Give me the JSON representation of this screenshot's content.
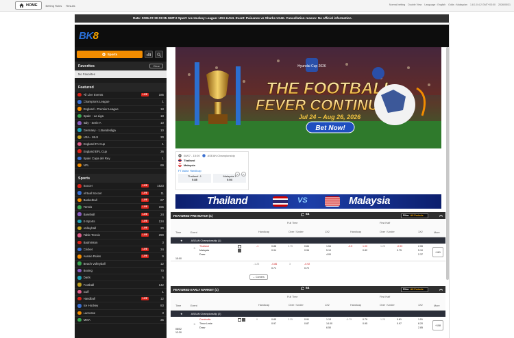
{
  "topbar": {
    "home": "HOME",
    "links": [
      "Betting Rules",
      "Results"
    ],
    "right": [
      "Normal betting",
      "Double View",
      "Language : English",
      "Odds : Malaysian",
      "1.8.1.0.4.2 GMT+03:00",
      "2026/05/31"
    ]
  },
  "notice": "Date: 2026-07-30 03:35 GMT-2 Sport: Ice Hockey League: USA UAHL Event: Paisanos vs Sharks UAHL Cancellation reason: No official information.",
  "brand": {
    "logo_a": "BK",
    "logo_b": "8"
  },
  "sidebar": {
    "sports_tab": "Sports",
    "favorites": "Favorites",
    "clear": "Clear",
    "no_favorites": "No Favorites",
    "featured": "Featured",
    "featured_items": [
      {
        "name": "All Live Events",
        "live": "LIVE",
        "count": "185"
      },
      {
        "name": "Champions League",
        "count": "1"
      },
      {
        "name": "England - Premier League",
        "count": "18"
      },
      {
        "name": "Spain - La Liga",
        "count": "18"
      },
      {
        "name": "Italy - Serie A",
        "count": "10"
      },
      {
        "name": "Germany - 1.Bundesliga",
        "count": "10"
      },
      {
        "name": "USA - MLS",
        "count": "30"
      },
      {
        "name": "England FA Cup",
        "count": "1"
      },
      {
        "name": "England EFL Cup",
        "count": "36"
      },
      {
        "name": "Spain Copa del Rey",
        "count": "1"
      },
      {
        "name": "NFL",
        "count": "69"
      }
    ],
    "sports": "Sports",
    "sports_items": [
      {
        "name": "Soccer",
        "live": "LIVE",
        "count": "1623"
      },
      {
        "name": "Virtual Soccer",
        "live": "LIVE",
        "count": "11"
      },
      {
        "name": "Basketball",
        "live": "LIVE",
        "count": "67"
      },
      {
        "name": "Tennis",
        "live": "LIVE",
        "count": "155"
      },
      {
        "name": "Baseball",
        "live": "LIVE",
        "count": "24"
      },
      {
        "name": "E-Sports",
        "live": "LIVE",
        "count": "134"
      },
      {
        "name": "Volleyball",
        "live": "LIVE",
        "count": "20"
      },
      {
        "name": "Table Tennis",
        "live": "LIVE",
        "count": "290"
      },
      {
        "name": "Badminton",
        "count": "3"
      },
      {
        "name": "Cricket",
        "live": "LIVE",
        "count": "34"
      },
      {
        "name": "Aussie Rules",
        "live": "LIVE",
        "count": "9"
      },
      {
        "name": "Beach Volleyball",
        "count": "12"
      },
      {
        "name": "Boxing",
        "count": "70"
      },
      {
        "name": "Darts",
        "count": "5"
      },
      {
        "name": "Football",
        "count": "142"
      },
      {
        "name": "Golf",
        "count": "1"
      },
      {
        "name": "Handball",
        "live": "LIVE",
        "count": "12"
      },
      {
        "name": "Ice Hockey",
        "count": "83"
      },
      {
        "name": "Lacrosse",
        "count": "3"
      },
      {
        "name": "MMA",
        "count": "35"
      }
    ]
  },
  "banner": {
    "title1": "THE FOOTBALL",
    "title2": "FEVER CONTINUES!",
    "dates": "Jul 24 – Aug 26, 2026",
    "cta": "Bet Now!",
    "trophy_text": "Hyundai Cup 2026"
  },
  "match_card": {
    "time": "08/07 - 15:00",
    "league": "ASEAN Championship",
    "team1": "Thailand",
    "team2": "Malaysia",
    "market": "FT Asian Handicap",
    "odd1_label": "Thailand -1",
    "odd1_val": "0.88",
    "odd2_label": "Malaysia 1",
    "odd2_val": "0.94"
  },
  "strip": {
    "left": "Thailand",
    "right": "Malaysia"
  },
  "pre": {
    "title": "FEATURED PRE-MATCH (1)",
    "count": "54",
    "filter_label": "Filter",
    "filter_value": "All Periods",
    "headers": {
      "time": "Time",
      "event": "Event",
      "full": "Full Time",
      "first": "First Half",
      "hdp": "Handicap",
      "ou": "Over / Under",
      "x12": "1X2",
      "more": "More"
    },
    "league": "ASEAN Championship (1)",
    "time": "15:00",
    "team1": "Thailand",
    "team2": "Malaysia",
    "draw": "Draw",
    "r1": {
      "ft_hl": "-1",
      "ft_h1": "0.88",
      "ft_h2": "0.94",
      "ft_ol": "2.75",
      "ft_o1": "0.84",
      "ft_o2": "0.96",
      "ft_x1": "1.54",
      "ft_x2": "5.10",
      "ft_x3": "4.00",
      "fh_hl": "-0.5",
      "fh_h1": "1.00",
      "fh_h2": "0.82",
      "fh_ol": "1.25",
      "fh_o1": "-0.93",
      "fh_o2": "0.75",
      "fh_x1": "2.06",
      "fh_x2": "5.10",
      "fh_x3": "2.37"
    },
    "r2": {
      "hl": "-1.25",
      "h1": "-0.86",
      "h2": "0.71",
      "ol": "3",
      "o1": "-0.92",
      "o2": "0.72"
    },
    "more": "+181",
    "corners": "Corners"
  },
  "early": {
    "title": "FEATURED EARLY MARKET (1)",
    "count": "54",
    "filter_label": "Filter",
    "filter_value": "All Periods",
    "league": "ASEAN Championship (2)",
    "date": "08/02",
    "time": "12:30",
    "team1": "Cambodia",
    "team2": "Timor Leste",
    "draw": "Draw",
    "r1": {
      "hl": "0",
      "h1": "0.85",
      "h2": "0.97",
      "ol": "2.25",
      "o1": "0.91",
      "o2": "0.87",
      "x1": "1.13",
      "x2": "14.00",
      "x3": "6.50",
      "fhl": "-0.75",
      "fh1": "0.79",
      "fh2": "0.95",
      "fol": "1.25",
      "fo1": "0.81",
      "fo2": "0.97",
      "fx1": "1.51",
      "fx2": "8.20",
      "fx3": "2.85"
    },
    "more": "+108"
  }
}
